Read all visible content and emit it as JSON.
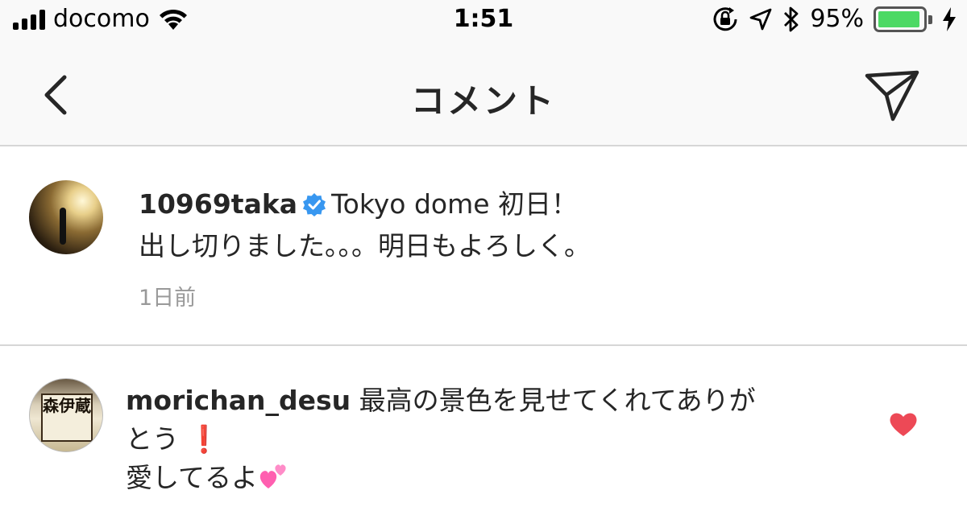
{
  "status_bar": {
    "carrier": "docomo",
    "time": "1:51",
    "battery_percent": "95%",
    "battery_level": 0.95,
    "icons": [
      "signal-bars-icon",
      "wifi-icon",
      "rotation-lock-icon",
      "location-arrow-icon",
      "bluetooth-icon",
      "battery-icon",
      "charging-bolt-icon"
    ]
  },
  "nav": {
    "title": "コメント",
    "back_icon": "chevron-left-icon",
    "send_icon": "paper-plane-icon"
  },
  "caption": {
    "username": "10969taka",
    "verified": true,
    "text_line1": "Tokyo dome 初日！",
    "text_line2": "出し切りました。。。明日もよろしく。",
    "time_ago": "1日前"
  },
  "comment": {
    "username": "morichan_desu",
    "text_line1": "最高の景色を見せてくれてありが",
    "text_line2": "とう",
    "text_emoji1": "❗",
    "text_line3": "愛してるよ",
    "liked": true,
    "avatar_label": "森伊蔵"
  },
  "colors": {
    "verified_blue": "#3897f0",
    "heart_red": "#ed4956",
    "battery_green": "#4cd964",
    "secondary_text": "#999999"
  }
}
